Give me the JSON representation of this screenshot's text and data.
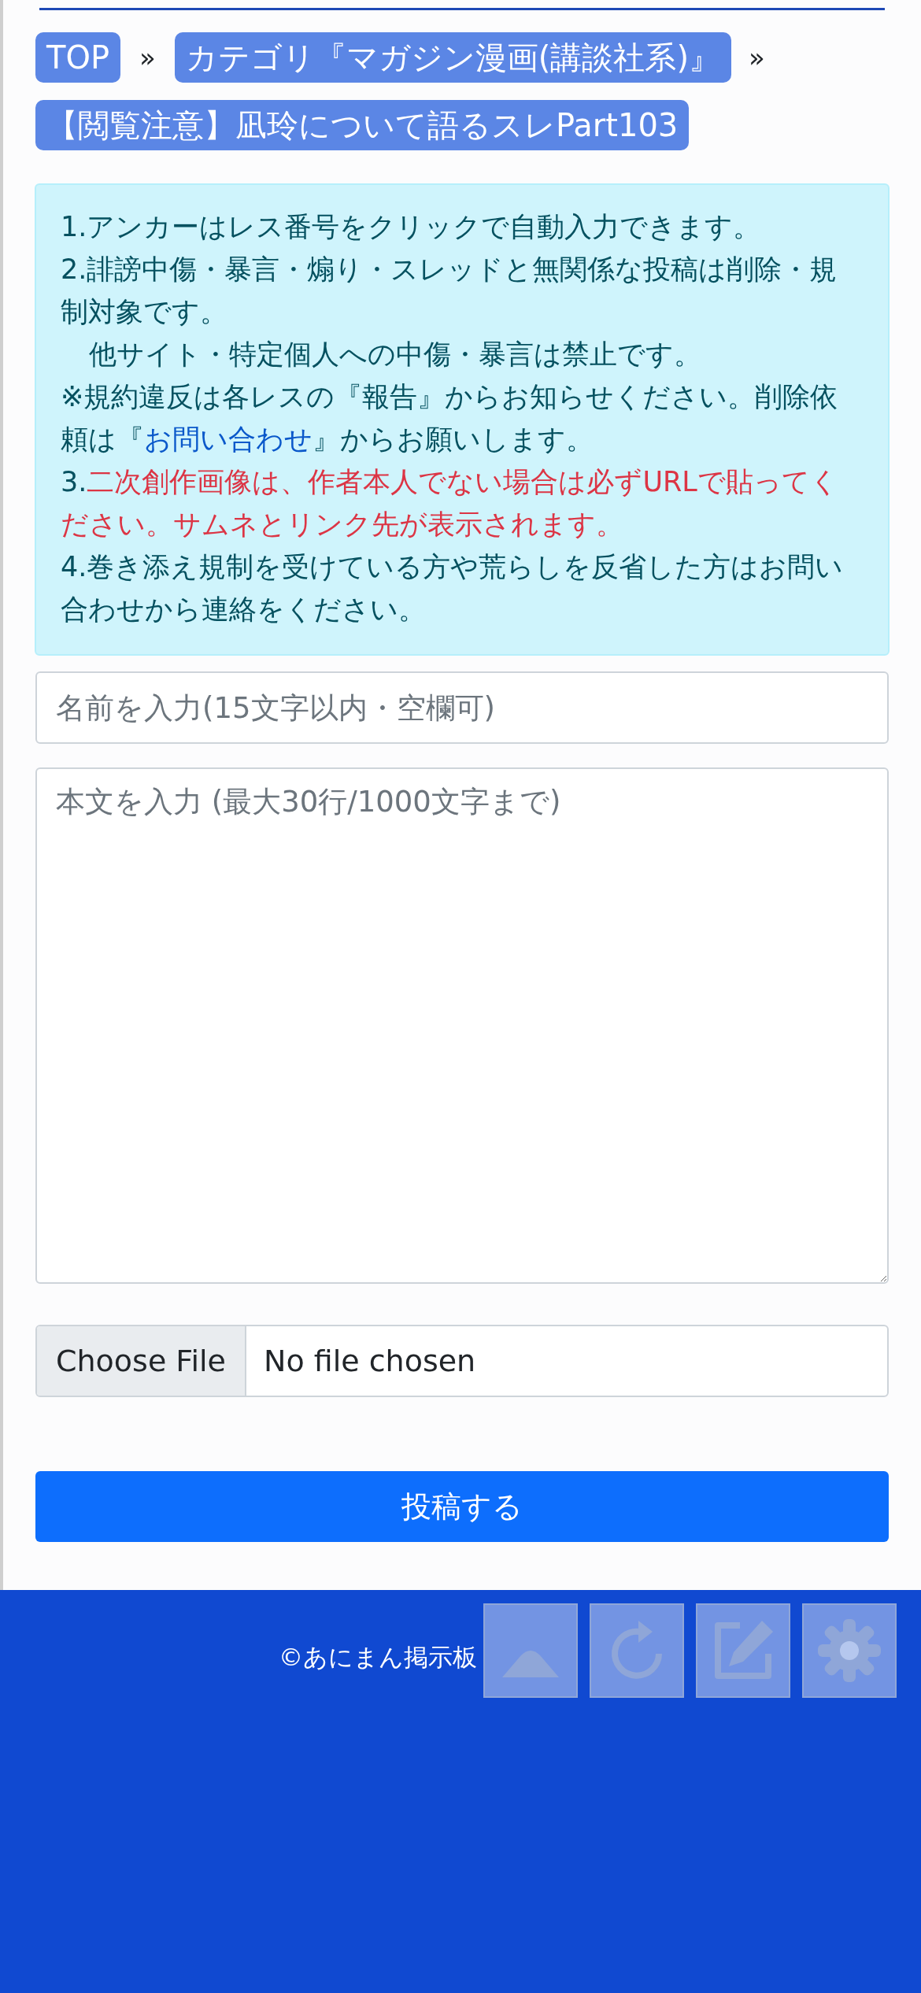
{
  "breadcrumb": [
    {
      "label": "TOP"
    },
    {
      "label": "カテゴリ『マガジン漫画(講談社系)』"
    },
    {
      "label": "【閲覧注意】凪玲について語るスレPart103"
    }
  ],
  "breadcrumb_separator": "»",
  "notice": [
    {
      "kind": "plain",
      "text": "1.アンカーはレス番号をクリックで自動入力できます。"
    },
    {
      "kind": "plain",
      "text": "2.誹謗中傷・暴言・煽り・スレッドと無関係な投稿は削除・規制対象です。"
    },
    {
      "kind": "indent",
      "text": "他サイト・特定個人への中傷・暴言は禁止です。"
    },
    {
      "kind": "with_link",
      "before": "※規約違反は各レスの『報告』からお知らせください。削除依頼は『",
      "link": "お問い合わせ",
      "after": "』からお願いします。"
    },
    {
      "kind": "warning",
      "number": "3.",
      "text": "二次創作画像は、作者本人でない場合は必ずURLで貼ってください。サムネとリンク先が表示されます。"
    },
    {
      "kind": "plain",
      "text": "4.巻き添え規制を受けている方や荒らしを反省した方はお問い合わせから連絡をください。"
    }
  ],
  "name_field": {
    "placeholder": "名前を入力(15文字以内・空欄可)"
  },
  "body_field": {
    "placeholder": "本文を入力 (最大30行/1000文字まで)"
  },
  "file_input": {
    "button": "Choose File",
    "status": "No file chosen"
  },
  "submit_button": "投稿する",
  "footer": {
    "copyright": "©あにまん掲示板"
  },
  "floating_buttons": [
    {
      "kind": "top"
    },
    {
      "kind": "reload"
    },
    {
      "kind": "edit"
    },
    {
      "kind": "settings"
    }
  ]
}
